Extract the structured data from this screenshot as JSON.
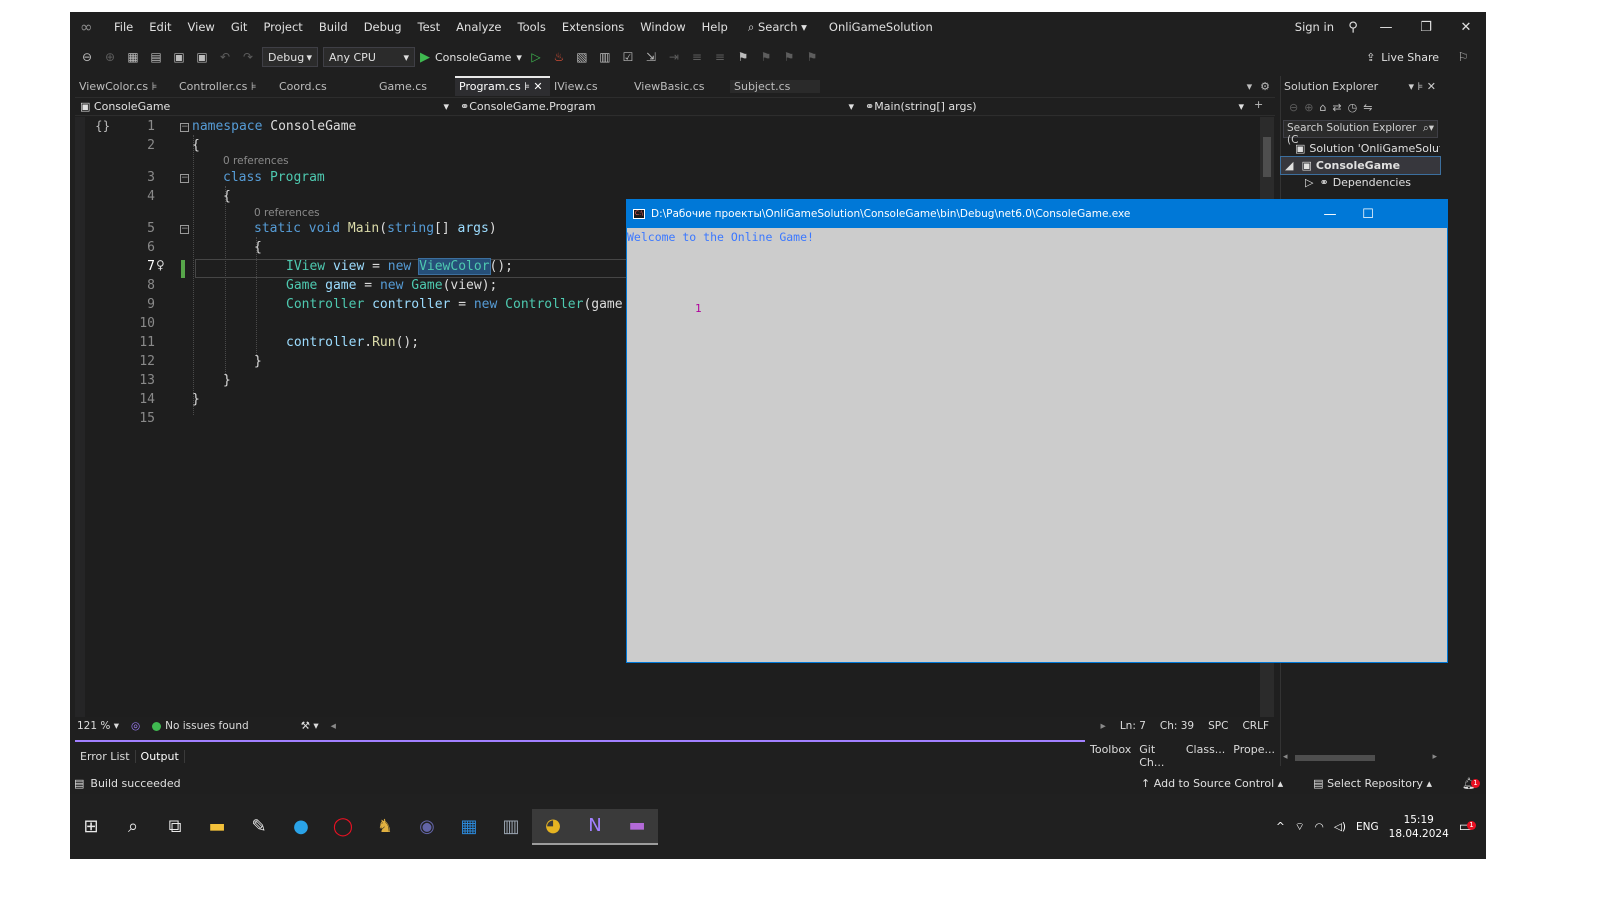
{
  "menubar": {
    "items": [
      "File",
      "Edit",
      "View",
      "Git",
      "Project",
      "Build",
      "Debug",
      "Test",
      "Analyze",
      "Tools",
      "Extensions",
      "Window",
      "Help"
    ],
    "search_label": "Search",
    "solution_name": "OnliGameSolution",
    "sign_in": "Sign in"
  },
  "toolbar": {
    "configuration": "Debug",
    "platform": "Any CPU",
    "run_target": "ConsoleGame",
    "live_share": "Live Share"
  },
  "tabs": [
    {
      "label": "ViewColor.cs",
      "active": false
    },
    {
      "label": "Controller.cs",
      "active": false
    },
    {
      "label": "Coord.cs",
      "active": false
    },
    {
      "label": "Game.cs",
      "active": false
    },
    {
      "label": "Program.cs",
      "active": true
    },
    {
      "label": "IView.cs",
      "active": false
    },
    {
      "label": "ViewBasic.cs",
      "active": false
    },
    {
      "label": "Subject.cs",
      "active": false
    }
  ],
  "navbar": {
    "project": "ConsoleGame",
    "type": "ConsoleGame.Program",
    "member": "Main(string[] args)"
  },
  "editor": {
    "line_numbers": [
      "1",
      "2",
      "3",
      "4",
      "5",
      "6",
      "7",
      "8",
      "9",
      "10",
      "11",
      "12",
      "13",
      "14",
      "15"
    ],
    "current_line": 7,
    "codelens_1": "0 references",
    "codelens_2": "0 references",
    "code": {
      "l1_kw": "namespace",
      "l1_name": " ConsoleGame",
      "l2": "{",
      "l3_kw": "class",
      "l3_name": " Program",
      "l4": "{",
      "l5_kw": "static void",
      "l5_m": " Main",
      "l5_p": "(",
      "l5_t": "string",
      "l5_r": "[] ",
      "l5_a": "args",
      "l5_e": ")",
      "l6": "{",
      "l7_t": "IView",
      "l7_v": " view",
      "l7_eq": " = ",
      "l7_new": "new",
      "l7_sp": " ",
      "l7_c": "ViewColor",
      "l7_e": "();",
      "l8_t": "Game",
      "l8_v": " game",
      "l8_eq": " = ",
      "l8_new": "new",
      "l8_sp": " ",
      "l8_c": "Game",
      "l8_e": "(view);",
      "l9_t": "Controller",
      "l9_v": " controller",
      "l9_eq": " = ",
      "l9_new": "new",
      "l9_sp": " ",
      "l9_c": "Controller",
      "l9_e": "(game",
      "l11_v": "controller",
      "l11_d": ".",
      "l11_m": "Run",
      "l11_e": "();",
      "l12": "}",
      "l13": "}",
      "l14": "}"
    }
  },
  "editor_status": {
    "zoom": "121 %",
    "issues": "No issues found",
    "line": "Ln: 7",
    "col": "Ch: 39",
    "spacing": "SPC",
    "eol": "CRLF"
  },
  "bottom_panel": {
    "tabs": [
      "Error List",
      "Output"
    ],
    "active_tab": "Output",
    "right_tabs": [
      "Toolbox",
      "Git Ch...",
      "Class...",
      "Prope..."
    ]
  },
  "solution_explorer": {
    "title": "Solution Explorer",
    "search_placeholder": "Search Solution Explorer (C",
    "items": [
      {
        "label": "Solution 'OnliGameSolution'",
        "indent": 0,
        "selected": false
      },
      {
        "label": "ConsoleGame",
        "indent": 1,
        "selected": true
      },
      {
        "label": "Dependencies",
        "indent": 2,
        "selected": false
      }
    ]
  },
  "console": {
    "title": "D:\\Рабочие проекты\\OnliGameSolution\\ConsoleGame\\bin\\Debug\\net6.0\\ConsoleGame.exe",
    "welcome": "Welcome to the Online Game!",
    "number": "1",
    "text_color": "#3b78ff",
    "number_color": "#b0009c"
  },
  "statusbar": {
    "message": "Build succeeded",
    "source_control": "Add to Source Control",
    "repository": "Select Repository",
    "notification_count": "1"
  },
  "taskbar": {
    "icons": [
      "windows-start-icon",
      "search-icon",
      "task-view-icon",
      "file-explorer-icon",
      "dev-app-icon",
      "edge-icon",
      "opera-icon",
      "game-app-icon",
      "teams-icon",
      "calendar-icon",
      "calculator-icon",
      "chrome-icon",
      "visual-studio-icon",
      "console-icon"
    ],
    "lang": "ENG",
    "time": "15:19",
    "date": "18.04.2024",
    "notification_count": "1"
  },
  "colors": {
    "accent": "#0078d7",
    "keyword": "#569cd6",
    "type": "#4ec9b0",
    "method": "#dcdcaa",
    "variable": "#9cdcfe",
    "success": "#3fb950",
    "output_underline": "#a280ff"
  }
}
